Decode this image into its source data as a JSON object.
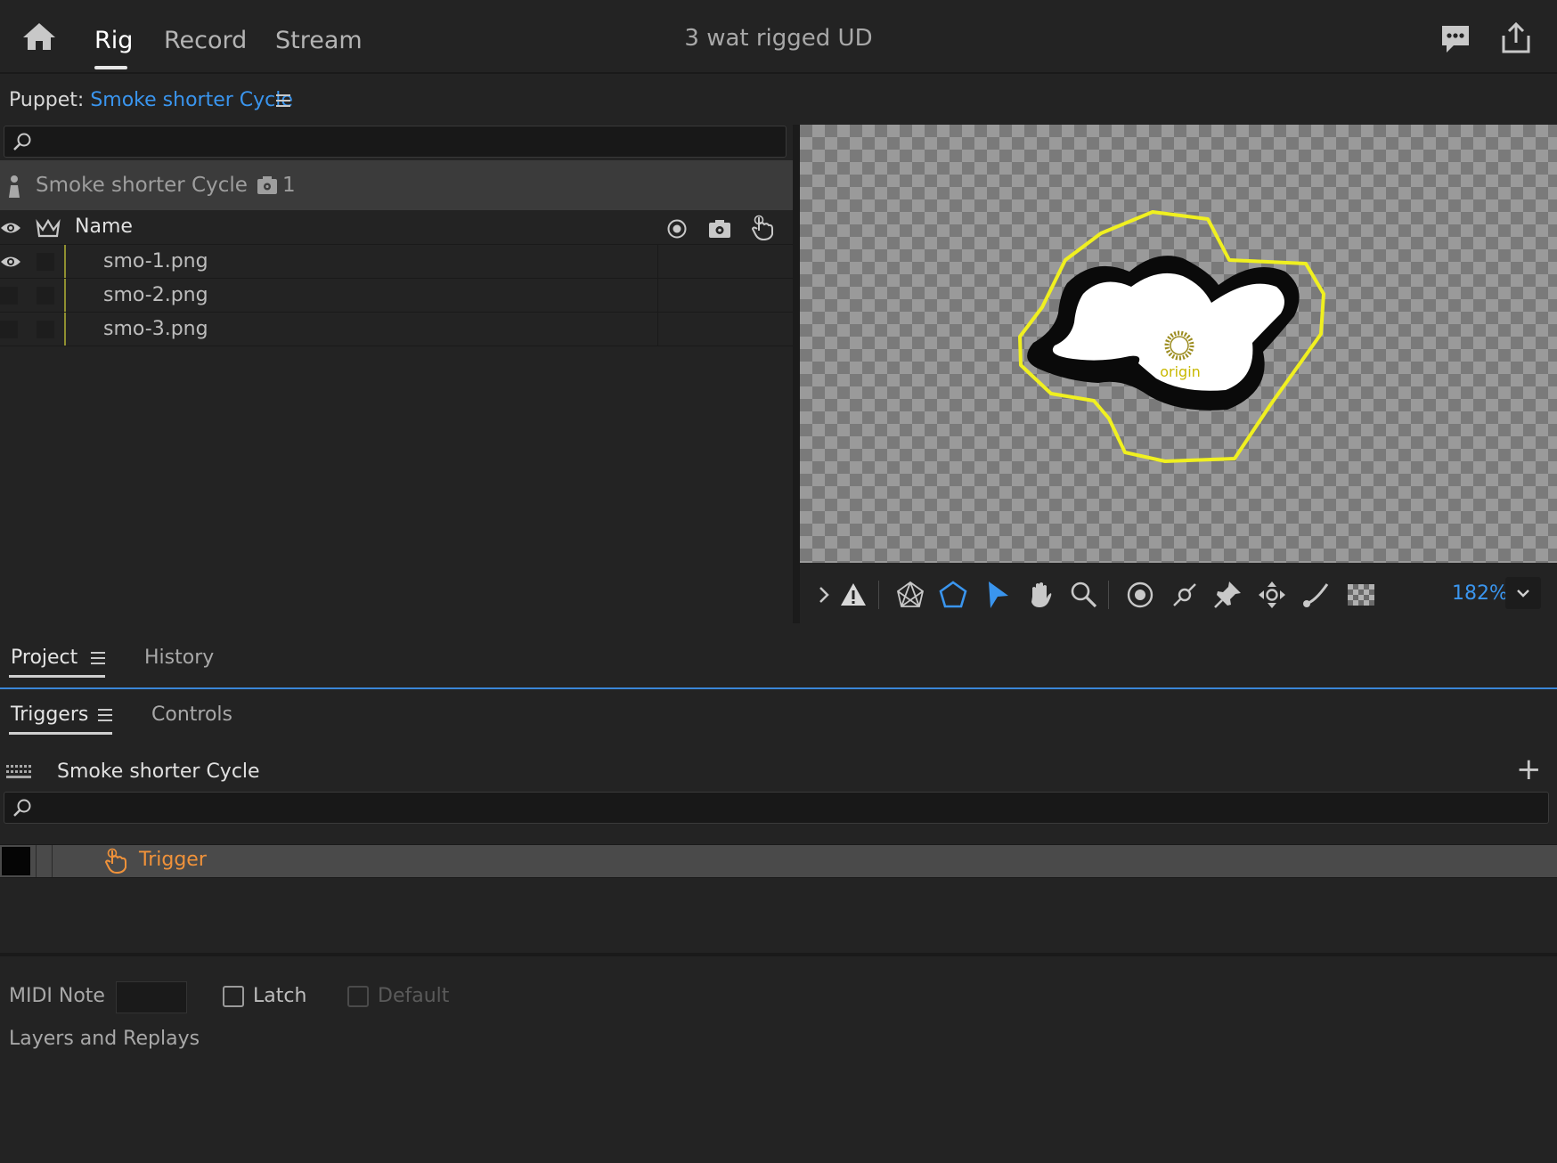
{
  "top_nav": {
    "home_icon": "home-icon",
    "tabs": [
      "Rig",
      "Record",
      "Stream"
    ],
    "active_tab": "Rig",
    "document_title": "3 wat rigged UD",
    "feedback_icon": "chat-bubble-icon",
    "share_icon": "share-icon"
  },
  "puppet_panel": {
    "label": "Puppet:",
    "puppet_name": "Smoke shorter Cycle",
    "search_placeholder": "",
    "root": {
      "name": "Smoke shorter Cycle",
      "trigger_count": "1"
    },
    "columns": {
      "name": "Name"
    },
    "layers": [
      {
        "name": "smo-1.png",
        "visible": true
      },
      {
        "name": "smo-2.png",
        "visible": false
      },
      {
        "name": "smo-3.png",
        "visible": false
      }
    ]
  },
  "stage": {
    "origin_label": "origin",
    "zoom": "182%"
  },
  "bottom_tabs": {
    "project": "Project",
    "history": "History"
  },
  "triggers_panel": {
    "tabs": [
      "Triggers",
      "Controls"
    ],
    "active_tab": "Triggers",
    "puppet_name": "Smoke shorter Cycle",
    "add_label": "+",
    "search_placeholder": "",
    "items": [
      {
        "name": "Trigger",
        "color": "#f0923a"
      }
    ],
    "midi_note_label": "MIDI Note",
    "midi_note_value": "",
    "latch_label": "Latch",
    "default_label": "Default",
    "layers_and_replays_label": "Layers and Replays"
  },
  "colors": {
    "accent_blue": "#3a95ee",
    "trigger_orange": "#f0923a",
    "selection_yellow": "#f0f020"
  }
}
